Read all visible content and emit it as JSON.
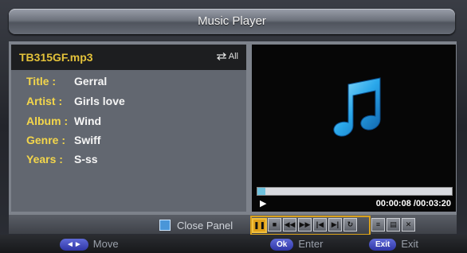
{
  "title": "Music Player",
  "info": {
    "filename": "TB315GF.mp3",
    "repeat_label": "All",
    "fields": [
      {
        "key": "Title :",
        "value": "Gerral"
      },
      {
        "key": "Artist :",
        "value": "Girls love"
      },
      {
        "key": "Album :",
        "value": "Wind"
      },
      {
        "key": "Genre :",
        "value": "Swiff"
      },
      {
        "key": "Years :",
        "value": "S-ss"
      }
    ]
  },
  "player": {
    "elapsed": "00:00:08",
    "total": "/00:03:20",
    "progress_fraction": 0.04
  },
  "controls": {
    "close_panel": "Close Panel"
  },
  "footer": {
    "move_key": "◄►",
    "move_label": "Move",
    "enter_key": "Ok",
    "enter_label": "Enter",
    "exit_key": "Exit",
    "exit_label": "Exit"
  },
  "colors": {
    "accent_yellow": "#e3c23a",
    "label_yellow": "#f3d64b",
    "progress_blue": "#6fc2de",
    "highlight_orange": "#e1a21a"
  }
}
